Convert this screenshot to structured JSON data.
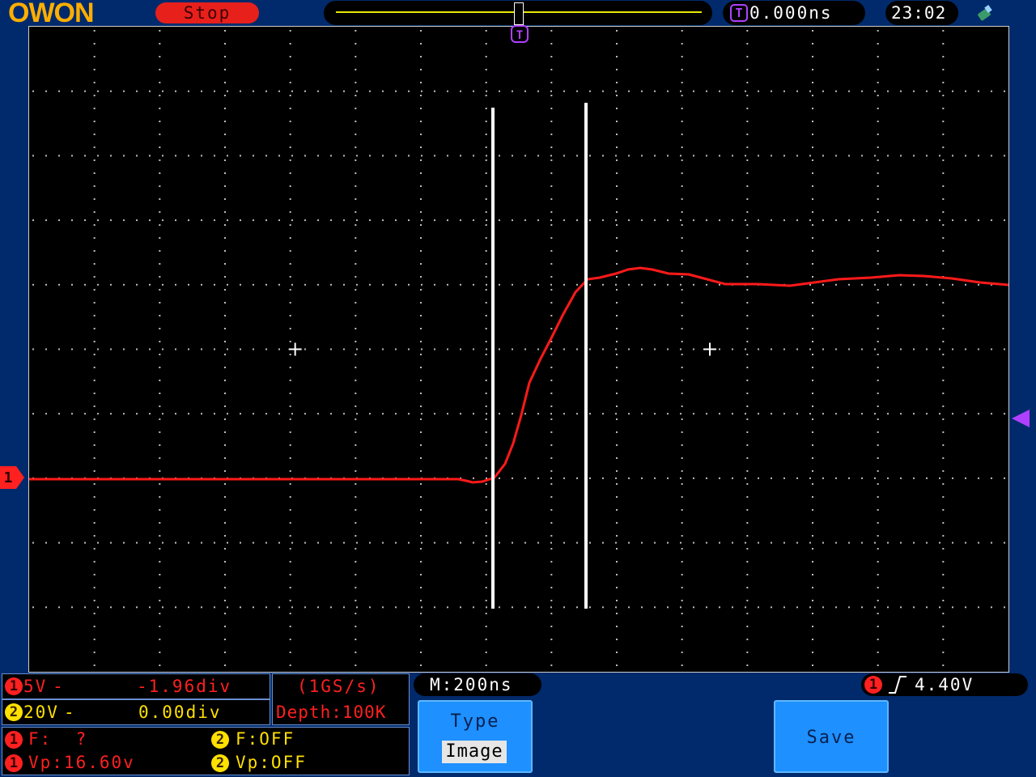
{
  "header": {
    "brand": "OWON",
    "run_state": "Stop",
    "trigger_marker_label": "T",
    "trigger_delay": "0.000ns",
    "clock": "23:02",
    "usb_icon": "usb-icon"
  },
  "screen": {
    "ch1_marker_label": "1",
    "trigger_level_icon": "triangle-left-icon",
    "trace_color": "#ff1a1a",
    "cursor_color": "#ffffff"
  },
  "channels": {
    "ch1": {
      "badge": "1",
      "volts_div": "5V",
      "coupling": "-",
      "offset": "-1.96div"
    },
    "ch2": {
      "badge": "2",
      "volts_div": "20V",
      "coupling": "-",
      "offset": "0.00div"
    }
  },
  "acquisition": {
    "sample_rate": "(1GS/s)",
    "depth": "Depth:100K"
  },
  "measurements": {
    "ch1_freq": "F:  ?",
    "ch2_freq": "F:OFF",
    "ch1_vp": "Vp:16.60v",
    "ch2_vp": "Vp:OFF"
  },
  "timebase": "M:200ns",
  "trigger": {
    "channel": "1",
    "level": "4.40V",
    "edge_icon": "rising-edge-icon"
  },
  "menu": {
    "type_label": "Type",
    "type_value": "Image",
    "save_label": "Save"
  },
  "colors": {
    "ch1": "#ff2020",
    "ch2": "#ffe000",
    "trigger": "#b040ff",
    "menu_button": "#1e90ff",
    "background": "#002a6b"
  }
}
